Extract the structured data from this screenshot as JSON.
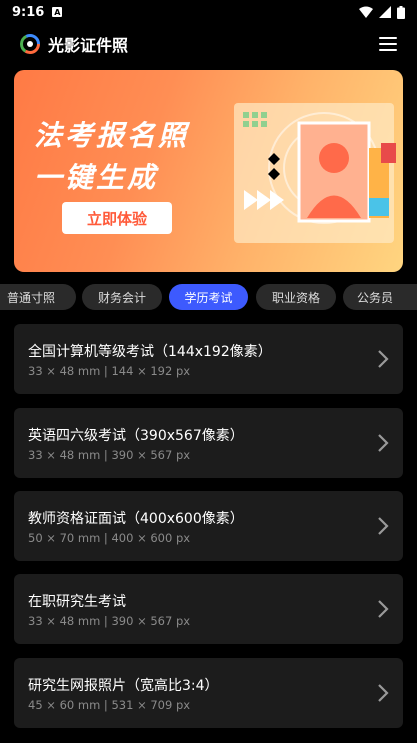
{
  "status": {
    "time": "9:16"
  },
  "app": {
    "title": "光影证件照"
  },
  "banner": {
    "line1": "法考报名照",
    "line2": "一键生成",
    "cta": "立即体验"
  },
  "tabs": [
    {
      "label": "普通寸照",
      "active": false
    },
    {
      "label": "财务会计",
      "active": false
    },
    {
      "label": "学历考试",
      "active": true
    },
    {
      "label": "职业资格",
      "active": false
    },
    {
      "label": "公务员",
      "active": false
    }
  ],
  "items": [
    {
      "title": "全国计算机等级考试（144x192像素）",
      "spec": "33 × 48 mm | 144 × 192 px"
    },
    {
      "title": "英语四六级考试（390x567像素）",
      "spec": "33 × 48 mm | 390 × 567 px"
    },
    {
      "title": "教师资格证面试（400x600像素）",
      "spec": "50 × 70 mm | 400 × 600 px"
    },
    {
      "title": "在职研究生考试",
      "spec": "33 × 48 mm | 390 × 567 px"
    },
    {
      "title": "研究生网报照片（宽高比3:4）",
      "spec": "45 × 60 mm | 531 × 709 px"
    }
  ],
  "colors": {
    "accent": "#3d5afe",
    "banner": "#ff7a45"
  }
}
